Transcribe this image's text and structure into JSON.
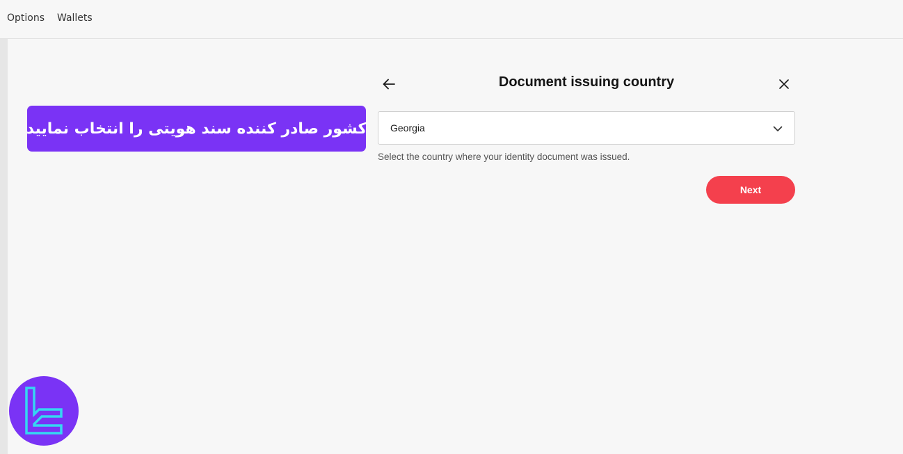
{
  "nav": {
    "options_label": "Options",
    "wallets_label": "Wallets"
  },
  "annotation": {
    "text": "کشور صادر کننده سند هویتی را انتخاب نمایید",
    "color": "#7a33f5"
  },
  "dialog": {
    "title": "Document issuing country",
    "back_icon": "arrow-left-icon",
    "close_icon": "close-icon",
    "country_select": {
      "value": "Georgia",
      "icon": "chevron-down-icon"
    },
    "helper_text": "Select the country where your identity document was issued.",
    "next_label": "Next",
    "next_color": "#f4404d"
  },
  "brand": {
    "logo_icon": "brand-logo-icon",
    "colors": {
      "background": "#7a33f5",
      "stroke": "#35d7f2"
    }
  }
}
